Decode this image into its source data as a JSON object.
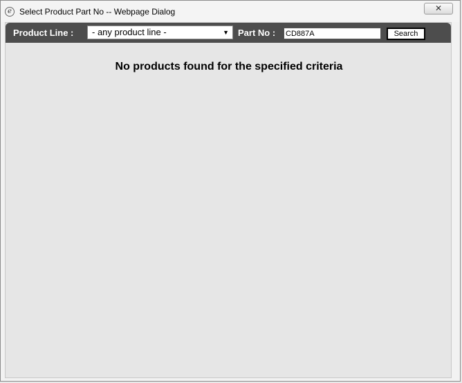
{
  "window": {
    "title": "Select Product Part No -- Webpage Dialog",
    "close_label": "✕",
    "icon": "ie-page-icon"
  },
  "toolbar": {
    "product_line_label": "Product Line :",
    "product_line_selected": "- any product line -",
    "part_no_label": "Part No :",
    "part_no_value": "CD887A",
    "search_label": "Search"
  },
  "results": {
    "message": "No products found for the specified criteria"
  }
}
